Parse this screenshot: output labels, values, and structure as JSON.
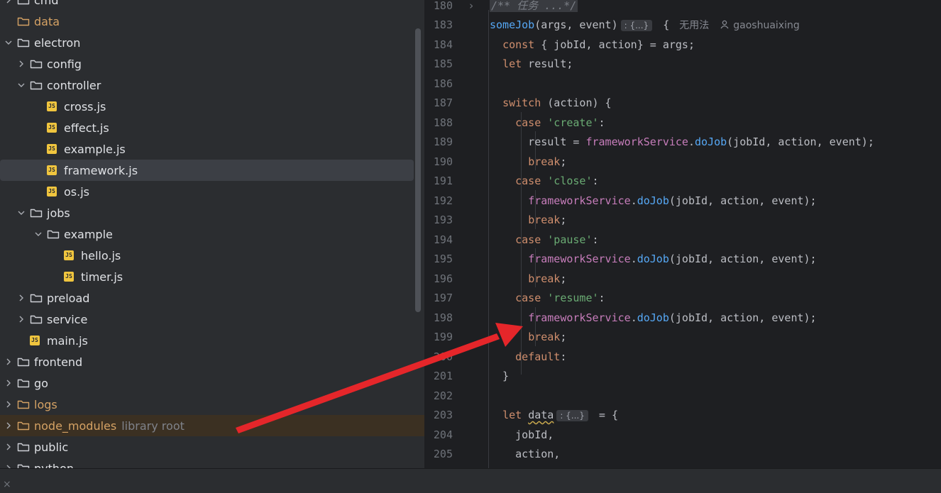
{
  "tree": {
    "rows": [
      {
        "label": "cmd",
        "type": "folder",
        "depth": 0,
        "chev": "right"
      },
      {
        "label": "data",
        "type": "folder",
        "depth": 0,
        "chev": "",
        "excluded": true
      },
      {
        "label": "electron",
        "type": "folder",
        "depth": 0,
        "chev": "down"
      },
      {
        "label": "config",
        "type": "folder",
        "depth": 1,
        "chev": "right"
      },
      {
        "label": "controller",
        "type": "folder",
        "depth": 1,
        "chev": "down"
      },
      {
        "label": "cross.js",
        "type": "js",
        "depth": 2,
        "chev": ""
      },
      {
        "label": "effect.js",
        "type": "js",
        "depth": 2,
        "chev": ""
      },
      {
        "label": "example.js",
        "type": "js",
        "depth": 2,
        "chev": ""
      },
      {
        "label": "framework.js",
        "type": "js",
        "depth": 2,
        "chev": "",
        "selected": true
      },
      {
        "label": "os.js",
        "type": "js",
        "depth": 2,
        "chev": ""
      },
      {
        "label": "jobs",
        "type": "folder",
        "depth": 1,
        "chev": "down"
      },
      {
        "label": "example",
        "type": "folder",
        "depth": 2,
        "chev": "down"
      },
      {
        "label": "hello.js",
        "type": "js",
        "depth": 3,
        "chev": ""
      },
      {
        "label": "timer.js",
        "type": "js",
        "depth": 3,
        "chev": ""
      },
      {
        "label": "preload",
        "type": "folder",
        "depth": 1,
        "chev": "right"
      },
      {
        "label": "service",
        "type": "folder",
        "depth": 1,
        "chev": "right"
      },
      {
        "label": "main.js",
        "type": "js",
        "depth": 1,
        "chev": ""
      },
      {
        "label": "frontend",
        "type": "folder",
        "depth": 0,
        "chev": "right"
      },
      {
        "label": "go",
        "type": "folder",
        "depth": 0,
        "chev": "right"
      },
      {
        "label": "logs",
        "type": "folder",
        "depth": 0,
        "chev": "right",
        "excluded": true
      },
      {
        "label": "node_modules",
        "type": "folder",
        "depth": 0,
        "chev": "right",
        "excluded": true,
        "hint": "library root",
        "lib": true
      },
      {
        "label": "public",
        "type": "folder",
        "depth": 0,
        "chev": "right"
      },
      {
        "label": "python",
        "type": "folder",
        "depth": 0,
        "chev": "right"
      }
    ]
  },
  "editor": {
    "lines": [
      {
        "n": "180",
        "fold": "›",
        "code": [
          {
            "t": "/** 任务 ...*/",
            "c": "cmt cmtbox"
          }
        ]
      },
      {
        "n": "183",
        "code": [
          {
            "t": "someJob",
            "c": "fn"
          },
          {
            "t": "(args, event)"
          },
          {
            "inlay": ": {...}"
          },
          {
            "t": " {"
          },
          {
            "usage": "无用法"
          },
          {
            "author": "gaoshuaixing"
          }
        ]
      },
      {
        "n": "184",
        "code": [
          {
            "t": "  "
          },
          {
            "t": "const",
            "c": "kw"
          },
          {
            "t": " { jobId, action} = args;"
          }
        ]
      },
      {
        "n": "185",
        "code": [
          {
            "t": "  "
          },
          {
            "t": "let",
            "c": "kw"
          },
          {
            "t": " result;"
          }
        ]
      },
      {
        "n": "186",
        "code": []
      },
      {
        "n": "187",
        "code": [
          {
            "t": "  "
          },
          {
            "t": "switch",
            "c": "kw"
          },
          {
            "t": " (action) {"
          }
        ]
      },
      {
        "n": "188",
        "code": [
          {
            "t": "    "
          },
          {
            "t": "case",
            "c": "kw"
          },
          {
            "t": " "
          },
          {
            "t": "'create'",
            "c": "str"
          },
          {
            "t": ":"
          }
        ]
      },
      {
        "n": "189",
        "code": [
          {
            "t": "      result = "
          },
          {
            "t": "frameworkService",
            "c": "pur"
          },
          {
            "t": "."
          },
          {
            "t": "doJob",
            "c": "fn"
          },
          {
            "t": "(jobId, action, event);"
          }
        ]
      },
      {
        "n": "190",
        "code": [
          {
            "t": "      "
          },
          {
            "t": "break",
            "c": "kw"
          },
          {
            "t": ";"
          }
        ]
      },
      {
        "n": "191",
        "code": [
          {
            "t": "    "
          },
          {
            "t": "case",
            "c": "kw"
          },
          {
            "t": " "
          },
          {
            "t": "'close'",
            "c": "str"
          },
          {
            "t": ":"
          }
        ]
      },
      {
        "n": "192",
        "code": [
          {
            "t": "      "
          },
          {
            "t": "frameworkService",
            "c": "pur"
          },
          {
            "t": "."
          },
          {
            "t": "doJob",
            "c": "fn"
          },
          {
            "t": "(jobId, action, event);"
          }
        ]
      },
      {
        "n": "193",
        "code": [
          {
            "t": "      "
          },
          {
            "t": "break",
            "c": "kw"
          },
          {
            "t": ";"
          }
        ]
      },
      {
        "n": "194",
        "code": [
          {
            "t": "    "
          },
          {
            "t": "case",
            "c": "kw"
          },
          {
            "t": " "
          },
          {
            "t": "'pause'",
            "c": "str"
          },
          {
            "t": ":"
          }
        ]
      },
      {
        "n": "195",
        "code": [
          {
            "t": "      "
          },
          {
            "t": "frameworkService",
            "c": "pur"
          },
          {
            "t": "."
          },
          {
            "t": "doJob",
            "c": "fn"
          },
          {
            "t": "(jobId, action, event);"
          }
        ]
      },
      {
        "n": "196",
        "code": [
          {
            "t": "      "
          },
          {
            "t": "break",
            "c": "kw"
          },
          {
            "t": ";"
          }
        ]
      },
      {
        "n": "197",
        "code": [
          {
            "t": "    "
          },
          {
            "t": "case",
            "c": "kw"
          },
          {
            "t": " "
          },
          {
            "t": "'resume'",
            "c": "str"
          },
          {
            "t": ":"
          }
        ]
      },
      {
        "n": "198",
        "code": [
          {
            "t": "      "
          },
          {
            "t": "frameworkService",
            "c": "pur"
          },
          {
            "t": "."
          },
          {
            "t": "doJob",
            "c": "fn"
          },
          {
            "t": "(jobId, action, event);"
          }
        ]
      },
      {
        "n": "199",
        "code": [
          {
            "t": "      "
          },
          {
            "t": "break",
            "c": "kw"
          },
          {
            "t": ";"
          }
        ]
      },
      {
        "n": "200",
        "code": [
          {
            "t": "    "
          },
          {
            "t": "default",
            "c": "kw"
          },
          {
            "t": ":"
          }
        ]
      },
      {
        "n": "201",
        "code": [
          {
            "t": "  }"
          }
        ]
      },
      {
        "n": "202",
        "code": []
      },
      {
        "n": "203",
        "code": [
          {
            "t": "  "
          },
          {
            "t": "let",
            "c": "kw"
          },
          {
            "t": " "
          },
          {
            "t": "data",
            "c": "wavy"
          },
          {
            "inlay": ": {...}"
          },
          {
            "t": " = {"
          }
        ]
      },
      {
        "n": "204",
        "code": [
          {
            "t": "    jobId,"
          }
        ]
      },
      {
        "n": "205",
        "code": [
          {
            "t": "    action,"
          }
        ]
      }
    ]
  },
  "bottom": {
    "close_glyph": "×"
  },
  "colors": {
    "arrow": "#e5262a",
    "tree_bg": "#2b2d30",
    "editor_bg": "#1e1f22"
  }
}
